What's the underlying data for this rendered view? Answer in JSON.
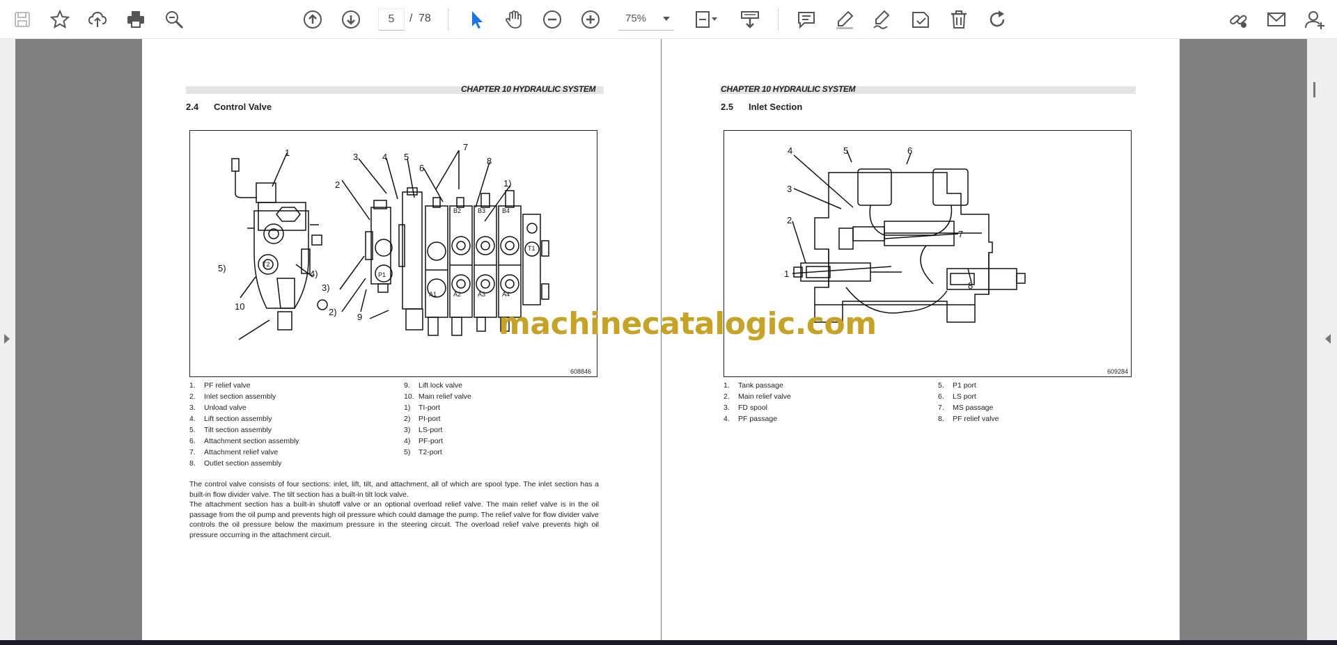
{
  "toolbar": {
    "left_icons": [
      "save-icon",
      "bookmark-star-icon",
      "upload-cloud-icon",
      "print-icon",
      "zoom-search-icon"
    ],
    "nav": {
      "current_page": "5",
      "separator": "/",
      "total_pages": "78"
    },
    "zoom": "75%",
    "right_icons": [
      "comment-icon",
      "highlight-pen-icon",
      "sign-icon",
      "stamp-icon",
      "delete-icon",
      "rotate-icon",
      "share-link-icon",
      "mail-icon",
      "add-user-icon"
    ],
    "accent_color": "#1a73e8"
  },
  "page_left": {
    "chapter": "CHAPTER 10 HYDRAULIC SYSTEM",
    "section_num": "2.4",
    "section_title": "Control Valve",
    "figure_code": "608846",
    "callouts": [
      "1",
      "2",
      "3",
      "4",
      "5",
      "6",
      "7",
      "8",
      "1)",
      "2)",
      "3)",
      "4)",
      "5)",
      "9",
      "10"
    ],
    "port_labels": [
      "A1",
      "A2",
      "A3",
      "A4",
      "B2",
      "B3",
      "B4",
      "P1",
      "T1",
      "T2"
    ],
    "legend_col1": [
      {
        "n": "1.",
        "t": "PF relief valve"
      },
      {
        "n": "2.",
        "t": "Inlet section assembly"
      },
      {
        "n": "3.",
        "t": "Unload valve"
      },
      {
        "n": "4.",
        "t": "Lift section assembly"
      },
      {
        "n": "5.",
        "t": "Tilt section assembly"
      },
      {
        "n": "6.",
        "t": "Attachment section assembly"
      },
      {
        "n": "7.",
        "t": "Attachment relief valve"
      },
      {
        "n": "8.",
        "t": "Outlet section assembly"
      }
    ],
    "legend_col2": [
      {
        "n": "9.",
        "t": "Lift lock valve"
      },
      {
        "n": "10.",
        "t": "Main relief valve"
      },
      {
        "n": "1)",
        "t": "TI-port"
      },
      {
        "n": "2)",
        "t": "PI-port"
      },
      {
        "n": "3)",
        "t": "LS-port"
      },
      {
        "n": "4)",
        "t": "PF-port"
      },
      {
        "n": "5)",
        "t": "T2-port"
      }
    ],
    "para1": "The control valve consists of four sections: inlet, lift, tilt, and attachment, all of which are spool type. The inlet section has a built-in flow divider valve. The tilt section has a built-in tilt lock valve.",
    "para2": "The attachment section has a built-in shutoff valve or an optional overload relief valve. The main relief valve is in the oil passage from the oil pump and prevents high oil pressure which could damage the pump. The relief valve for flow divider valve controls the oil pressure below the maximum pressure in the steering circuit. The overload relief valve prevents high oil pressure occurring in the attachment circuit."
  },
  "page_right": {
    "chapter": "CHAPTER 10 HYDRAULIC SYSTEM",
    "section_num": "2.5",
    "section_title": "Inlet Section",
    "figure_code": "609284",
    "callouts": [
      "1",
      "2",
      "3",
      "4",
      "5",
      "6",
      "7",
      "8"
    ],
    "legend_col1": [
      {
        "n": "1.",
        "t": "Tank passage"
      },
      {
        "n": "2.",
        "t": "Main relief valve"
      },
      {
        "n": "3.",
        "t": "FD spool"
      },
      {
        "n": "4.",
        "t": "PF passage"
      }
    ],
    "legend_col2": [
      {
        "n": "5.",
        "t": "P1 port"
      },
      {
        "n": "6.",
        "t": "LS port"
      },
      {
        "n": "7.",
        "t": "MS passage"
      },
      {
        "n": "8.",
        "t": "PF relief valve"
      }
    ]
  },
  "watermark": "machinecatalogic.com"
}
